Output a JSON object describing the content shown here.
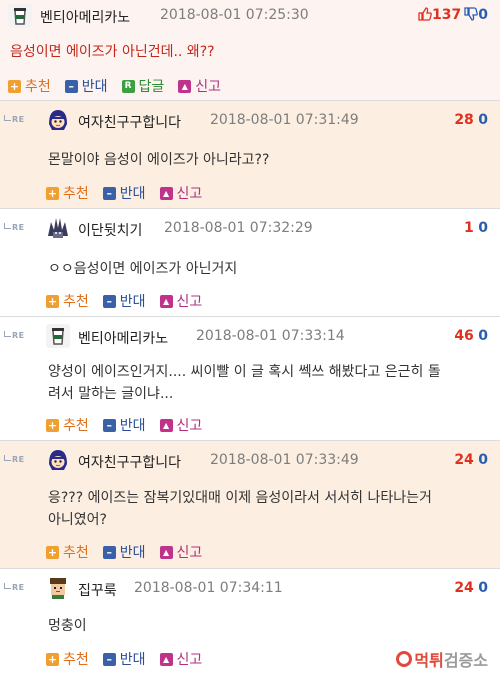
{
  "actions": {
    "recommend": "추천",
    "oppose": "반대",
    "reply": "답글",
    "report": "신고"
  },
  "re_label": "RE",
  "original": {
    "nickname": "벤티아메리카노",
    "time": "2018-08-01 07:25:30",
    "up": "137",
    "down": "0",
    "text": "음성이면 에이즈가 아닌건데.. 왜??"
  },
  "comments": [
    {
      "nickname": "여자친구구합니다",
      "time": "2018-08-01 07:31:49",
      "up": "28",
      "down": "0",
      "lines": [
        "몬말이야 음성이 에이즈가 아니라고??"
      ],
      "highlight": true,
      "avatar": "girl-avatar"
    },
    {
      "nickname": "이단뒷치기",
      "time": "2018-08-01 07:32:29",
      "up": "1",
      "down": "0",
      "lines": [
        "ㅇㅇ음성이면 에이즈가 아닌거지"
      ],
      "highlight": false,
      "avatar": "spiky-avatar"
    },
    {
      "nickname": "벤티아메리카노",
      "time": "2018-08-01 07:33:14",
      "up": "46",
      "down": "0",
      "lines": [
        "양성이 에이즈인거지.... 씨이빨 이 글 혹시 쎅쓰 해봤다고 은근히 돌",
        "려서 말하는 글이냐..."
      ],
      "highlight": false,
      "avatar": "cup-avatar"
    },
    {
      "nickname": "여자친구구합니다",
      "time": "2018-08-01 07:33:49",
      "up": "24",
      "down": "0",
      "lines": [
        "응??? 에이즈는 잠복기있대매 이제 음성이라서 서서히 나타나는거",
        "아니였어?"
      ],
      "highlight": true,
      "avatar": "girl-avatar"
    },
    {
      "nickname": "집꾸룩",
      "time": "2018-08-01 07:34:11",
      "up": "24",
      "down": "0",
      "lines": [
        "멍충이"
      ],
      "highlight": false,
      "avatar": "pixel-avatar"
    }
  ],
  "watermark": {
    "part1": "먹튀",
    "part2": "검증소"
  },
  "colors": {
    "highlight_bg": "#fcefe2",
    "up": "#e0301e",
    "down": "#2a5db0"
  }
}
